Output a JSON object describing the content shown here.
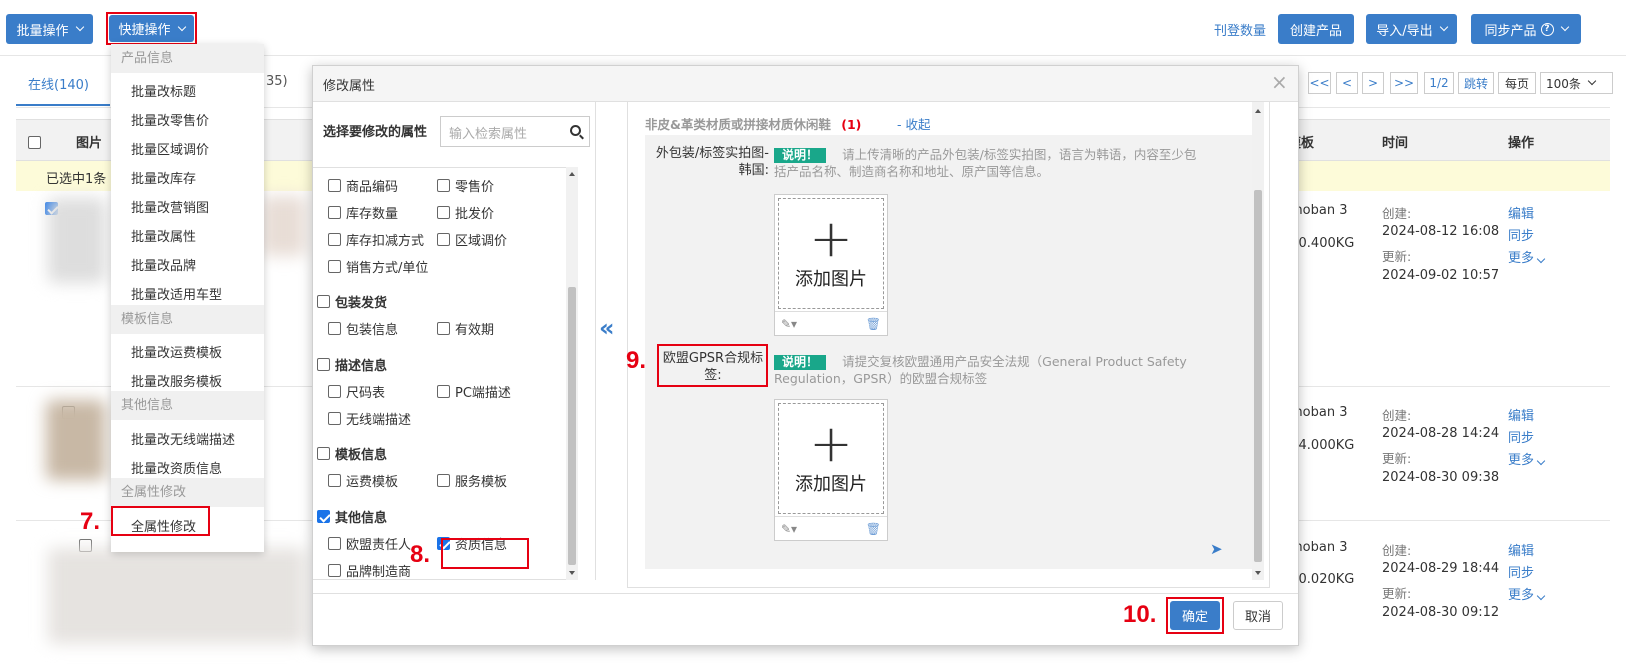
{
  "toolbar": {
    "batch_ops": "批量操作",
    "quick_ops": "快捷操作",
    "listing_count": "刊登数量",
    "create_product": "创建产品",
    "import_export": "导入/导出",
    "sync_product": "同步产品"
  },
  "tabs": {
    "online": "在线(140)",
    "partial": "35)"
  },
  "pagination": {
    "first": "<<",
    "prev": "<",
    "next": ">",
    "last": ">>",
    "page": "1/2",
    "jump": "跳转",
    "per_page": "每页",
    "per_page_value": "100条"
  },
  "table": {
    "col_image": "图片",
    "col_template": "模板",
    "col_time": "时间",
    "col_ops": "操作",
    "selected_banner": "已选中1条",
    "rows": [
      {
        "template": "moban 3",
        "weight": "0.400KG",
        "created_label": "创建:",
        "created": "2024-08-12 16:08",
        "updated_label": "更新:",
        "updated": "2024-09-02 10:57",
        "edit": "编辑",
        "sync": "同步",
        "more": "更多"
      },
      {
        "template": "moban 3",
        "weight": "4.000KG",
        "created_label": "创建:",
        "created": "2024-08-28 14:24",
        "updated_label": "更新:",
        "updated": "2024-08-30 09:38",
        "edit": "编辑",
        "sync": "同步",
        "more": "更多"
      },
      {
        "template": "moban 3",
        "weight": "0.020KG",
        "created_label": "创建:",
        "created": "2024-08-29 18:44",
        "updated_label": "更新:",
        "updated": "2024-08-30 09:12",
        "edit": "编辑",
        "sync": "同步",
        "more": "更多"
      }
    ]
  },
  "dropdown": {
    "group_product": "产品信息",
    "item1": "批量改标题",
    "item2": "批量改零售价",
    "item3": "批量区域调价",
    "item4": "批量改库存",
    "item5": "批量改营销图",
    "item6": "批量改属性",
    "item7": "批量改品牌",
    "item8": "批量改适用车型",
    "group_template": "模板信息",
    "item9": "批量改运费模板",
    "item10": "批量改服务模板",
    "group_other": "其他信息",
    "item11": "批量改无线端描述",
    "item12": "批量改资质信息",
    "group_all": "全属性修改",
    "item13": "全属性修改"
  },
  "modal": {
    "title": "修改属性",
    "close": "×",
    "select_label": "选择要修改的属性",
    "search_placeholder": "输入检索属性",
    "attrs": {
      "a1": "商品编码",
      "a2": "零售价",
      "a3": "库存数量",
      "a4": "批发价",
      "a5": "库存扣减方式",
      "a6": "区域调价",
      "a7": "销售方式/单位",
      "g1": "包装发货",
      "a8": "包装信息",
      "a9": "有效期",
      "g2": "描述信息",
      "a10": "尺码表",
      "a11": "PC端描述",
      "a12": "无线端描述",
      "g3": "模板信息",
      "a13": "运费模板",
      "a14": "服务模板",
      "g4": "其他信息",
      "a15": "欧盟责任人",
      "a16": "资质信息",
      "a17": "品牌制造商"
    },
    "section_title": "非皮&革类材质或拼接材质休闲鞋",
    "section_count": "(1)",
    "collapse": "- 收起",
    "field1_label": "外包装/标签实拍图-韩国:",
    "field1_tag": "说明！",
    "field1_desc": "请上传清晰的产品外包装/标签实拍图，语言为韩语，内容至少包括产品名称、制造商名称和地址、原产国等信息。",
    "field2_label": "欧盟GPSR合规标签:",
    "field2_tag": "说明！",
    "field2_desc": "请提交复核欧盟通用产品安全法规（General Product Safety Regulation，GPSR）的欧盟合规标签",
    "add_image": "添加图片",
    "confirm": "确定",
    "cancel": "取消"
  },
  "annotations": {
    "n7": "7.",
    "n8": "8.",
    "n9": "9.",
    "n10": "10."
  }
}
